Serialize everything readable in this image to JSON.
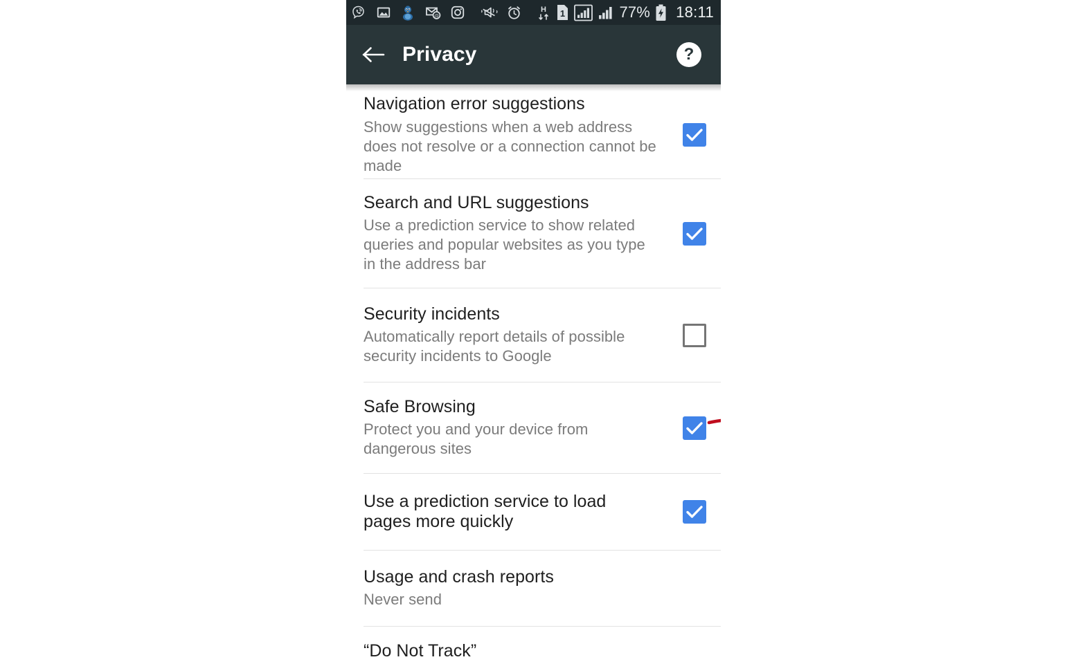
{
  "status_bar": {
    "background": "#1e282c",
    "icons": [
      {
        "name": "viber-icon",
        "label": "Viber"
      },
      {
        "name": "image-icon",
        "label": "Photo"
      },
      {
        "name": "bird-avatar-icon",
        "label": "Bird"
      },
      {
        "name": "email-at-icon",
        "label": "Email"
      },
      {
        "name": "instagram-icon",
        "label": "Instagram"
      },
      {
        "name": "vibrate-mute-icon",
        "label": "Vibrate"
      },
      {
        "name": "alarm-clock-icon",
        "label": "Alarm"
      }
    ],
    "network_type": "H",
    "sim_indicator": "1",
    "battery_percent": "77%",
    "clock": "18:11"
  },
  "app_bar": {
    "background": "#293639",
    "back_label": "Back",
    "title": "Privacy",
    "help_label": "?"
  },
  "settings": {
    "accent_color": "#4083e8",
    "items": [
      {
        "title": "Navigation error suggestions",
        "subtitle": "Show suggestions when a web address does not resolve or a connection cannot be made",
        "control": "checkbox",
        "checked": true
      },
      {
        "title": "Search and URL suggestions",
        "subtitle": "Use a prediction service to show related queries and popular websites as you type in the address bar",
        "control": "checkbox",
        "checked": true
      },
      {
        "title": "Security incidents",
        "subtitle": "Automatically report details of possible security incidents to Google",
        "control": "checkbox",
        "checked": false
      },
      {
        "title": "Safe Browsing",
        "subtitle": "Protect you and your device from dangerous sites",
        "control": "checkbox",
        "checked": true
      },
      {
        "title": "Use a prediction service to load pages more quickly",
        "subtitle": "",
        "control": "checkbox",
        "checked": true
      },
      {
        "title": "Usage and crash reports",
        "subtitle": "Never send",
        "control": "none",
        "checked": false
      },
      {
        "title": "“Do Not Track”",
        "subtitle": "",
        "control": "none",
        "checked": false
      }
    ]
  },
  "annotations": {
    "color": "#c00d1e",
    "underline_target": "Safe Browsing",
    "circle_target": "Safe Browsing checkbox"
  }
}
